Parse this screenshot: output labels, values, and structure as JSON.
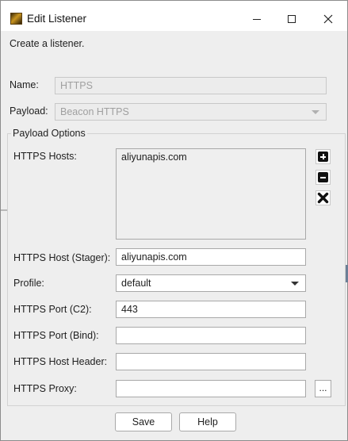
{
  "window": {
    "title": "Edit Listener",
    "app_icon": "cobalt-strike-icon",
    "controls": [
      "minimize-icon",
      "maximize-icon",
      "close-icon"
    ]
  },
  "intro": "Create a listener.",
  "name": {
    "label": "Name:",
    "value": "HTTPS"
  },
  "payload": {
    "label": "Payload:",
    "value": "Beacon HTTPS"
  },
  "options": {
    "title": "Payload Options",
    "hosts": {
      "label": "HTTPS Hosts:",
      "items": [
        "aliyunapis.com"
      ],
      "actions": [
        "add-icon",
        "remove-icon",
        "clear-icon"
      ]
    },
    "stager": {
      "label": "HTTPS Host (Stager):",
      "value": "aliyunapis.com"
    },
    "profile": {
      "label": "Profile:",
      "value": "default"
    },
    "port_c2": {
      "label": "HTTPS Port (C2):",
      "value": "443"
    },
    "port_bind": {
      "label": "HTTPS Port (Bind):",
      "value": ""
    },
    "host_header": {
      "label": "HTTPS Host Header:",
      "value": ""
    },
    "proxy": {
      "label": "HTTPS Proxy:",
      "value": "",
      "browse_label": "..."
    }
  },
  "footer": {
    "save_label": "Save",
    "help_label": "Help"
  }
}
